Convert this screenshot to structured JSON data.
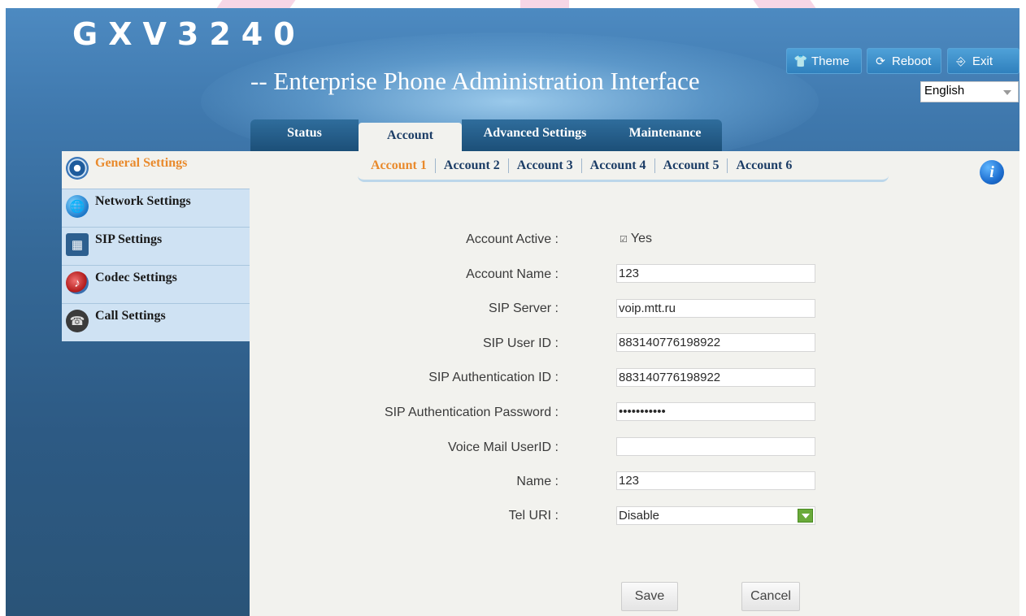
{
  "header": {
    "logo": "GXV3240",
    "subtitle": "-- Enterprise Phone Administration Interface",
    "buttons": {
      "theme": "Theme",
      "reboot": "Reboot",
      "exit": "Exit"
    },
    "language": "English"
  },
  "main_tabs": [
    {
      "label": "Status"
    },
    {
      "label": "Account",
      "active": true
    },
    {
      "label": "Advanced Settings"
    },
    {
      "label": "Maintenance"
    }
  ],
  "sidebar": {
    "items": [
      {
        "label": "General Settings",
        "icon": "general-settings-icon",
        "active": true
      },
      {
        "label": "Network Settings",
        "icon": "network-globe-icon"
      },
      {
        "label": "SIP Settings",
        "icon": "sip-phone-icon"
      },
      {
        "label": "Codec Settings",
        "icon": "codec-icon"
      },
      {
        "label": "Call Settings",
        "icon": "telephone-icon"
      }
    ]
  },
  "account_tabs": [
    {
      "label": "Account 1",
      "active": true
    },
    {
      "label": "Account 2"
    },
    {
      "label": "Account 3"
    },
    {
      "label": "Account 4"
    },
    {
      "label": "Account 5"
    },
    {
      "label": "Account 6"
    }
  ],
  "form": {
    "account_active": {
      "label": "Account Active :",
      "value": "Yes",
      "checked": true
    },
    "account_name": {
      "label": "Account Name :",
      "value": "123"
    },
    "sip_server": {
      "label": "SIP Server :",
      "value": "voip.mtt.ru"
    },
    "sip_user_id": {
      "label": "SIP User ID :",
      "value": "883140776198922"
    },
    "sip_auth_id": {
      "label": "SIP Authentication ID :",
      "value": "883140776198922"
    },
    "sip_auth_password": {
      "label": "SIP Authentication Password :",
      "value": "•••••••••••"
    },
    "voice_mail_userid": {
      "label": "Voice Mail UserID :",
      "value": ""
    },
    "name": {
      "label": "Name :",
      "value": "123"
    },
    "tel_uri": {
      "label": "Tel URI :",
      "value": "Disable"
    }
  },
  "actions": {
    "save": "Save",
    "cancel": "Cancel"
  },
  "colors": {
    "active_orange": "#e98a2c",
    "nav_blue": "#1c3d66",
    "header_blue": "#3f78ad"
  }
}
